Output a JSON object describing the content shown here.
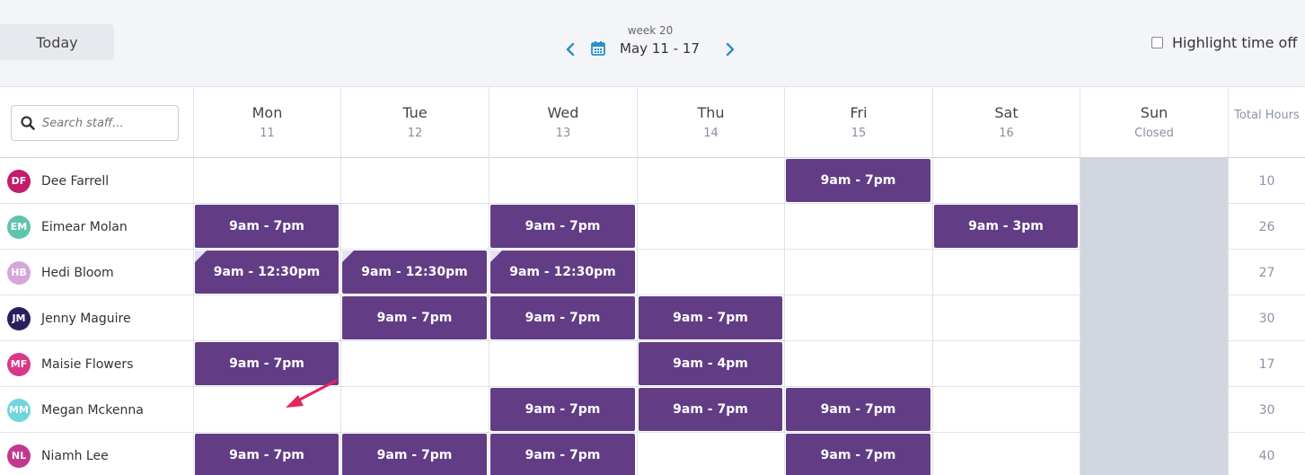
{
  "toolbar": {
    "today_label": "Today",
    "week_label": "week 20",
    "date_range": "May 11 - 17",
    "highlight_label": "Highlight time off",
    "highlight_checked": false
  },
  "search": {
    "placeholder": "Search staff..."
  },
  "days": [
    {
      "name": "Mon",
      "sub": "11"
    },
    {
      "name": "Tue",
      "sub": "12"
    },
    {
      "name": "Wed",
      "sub": "13"
    },
    {
      "name": "Thu",
      "sub": "14"
    },
    {
      "name": "Fri",
      "sub": "15"
    },
    {
      "name": "Sat",
      "sub": "16"
    },
    {
      "name": "Sun",
      "sub": "Closed"
    }
  ],
  "total_header": "Total Hours",
  "colors": {
    "shift": "#623d86",
    "closed": "#d2d6e0",
    "accent": "#2a8fc7",
    "arrow": "#e8245f"
  },
  "staff": [
    {
      "initials": "DF",
      "name": "Dee Farrell",
      "avatar_color": "#c21d68",
      "shifts": [
        "",
        "",
        "",
        "",
        "9am - 7pm",
        "",
        ""
      ],
      "total": "10"
    },
    {
      "initials": "EM",
      "name": "Eimear Molan",
      "avatar_color": "#5fc4ae",
      "shifts": [
        "9am - 7pm",
        "",
        "9am - 7pm",
        "",
        "",
        "9am - 3pm",
        ""
      ],
      "total": "26"
    },
    {
      "initials": "HB",
      "name": "Hedi Bloom",
      "avatar_color": "#d6a6da",
      "shifts": [
        "9am - 12:30pm",
        "9am - 12:30pm",
        "9am - 12:30pm",
        "",
        "",
        "",
        ""
      ],
      "total": "27",
      "marked": [
        true,
        true,
        true,
        false,
        false,
        false,
        false
      ]
    },
    {
      "initials": "JM",
      "name": "Jenny Maguire",
      "avatar_color": "#2a1f5e",
      "shifts": [
        "",
        "9am - 7pm",
        "9am - 7pm",
        "9am - 7pm",
        "",
        "",
        ""
      ],
      "total": "30"
    },
    {
      "initials": "MF",
      "name": "Maisie Flowers",
      "avatar_color": "#d9388a",
      "shifts": [
        "9am - 7pm",
        "",
        "",
        "9am - 4pm",
        "",
        "",
        ""
      ],
      "total": "17"
    },
    {
      "initials": "MM",
      "name": "Megan Mckenna",
      "avatar_color": "#6fd6dc",
      "shifts": [
        "",
        "",
        "9am - 7pm",
        "9am - 7pm",
        "9am - 7pm",
        "",
        ""
      ],
      "total": "30"
    },
    {
      "initials": "NL",
      "name": "Niamh Lee",
      "avatar_color": "#c2388e",
      "shifts": [
        "9am - 7pm",
        "9am - 7pm",
        "9am - 7pm",
        "",
        "9am - 7pm",
        "",
        ""
      ],
      "total": "40"
    }
  ]
}
